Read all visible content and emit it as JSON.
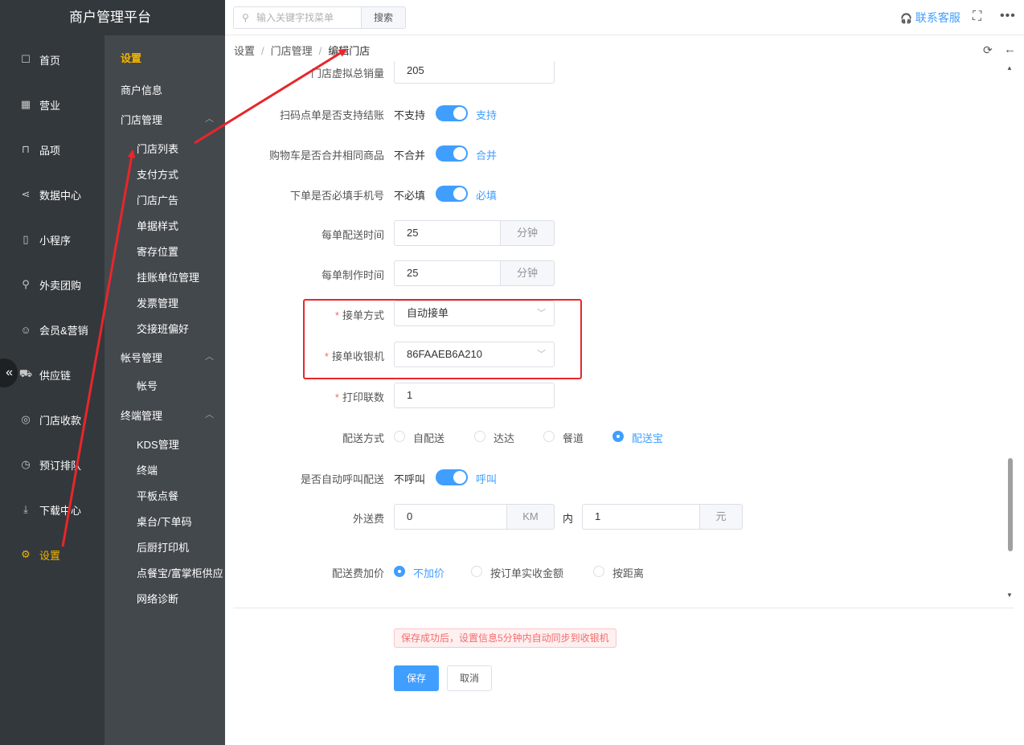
{
  "app": {
    "title": "商户管理平台"
  },
  "nav": {
    "items": [
      {
        "label": "首页",
        "icon": "home-icon",
        "glyph": "☐"
      },
      {
        "label": "营业",
        "icon": "calendar-icon",
        "glyph": "▦"
      },
      {
        "label": "品项",
        "icon": "bag-icon",
        "glyph": "⊓"
      },
      {
        "label": "数据中心",
        "icon": "share-icon",
        "glyph": "⋖"
      },
      {
        "label": "小程序",
        "icon": "phone-icon",
        "glyph": "▯"
      },
      {
        "label": "外卖团购",
        "icon": "bike-icon",
        "glyph": "⚲"
      },
      {
        "label": "会员&营销",
        "icon": "user-icon",
        "glyph": "☺"
      },
      {
        "label": "供应链",
        "icon": "truck-icon",
        "glyph": "⛟"
      },
      {
        "label": "门店收款",
        "icon": "coin-icon",
        "glyph": "◎"
      },
      {
        "label": "预订排队",
        "icon": "clock-icon",
        "glyph": "◷"
      },
      {
        "label": "下载中心",
        "icon": "download-icon",
        "glyph": "⤓"
      },
      {
        "label": "设置",
        "icon": "gear-icon",
        "glyph": "⚙"
      }
    ],
    "collapse_glyph": "«"
  },
  "subnav": {
    "title": "设置",
    "merchant_info": "商户信息",
    "store_group": "门店管理",
    "store_items": [
      "门店列表",
      "支付方式",
      "门店广告",
      "单据样式",
      "寄存位置",
      "挂账单位管理",
      "发票管理",
      "交接班偏好"
    ],
    "account_group": "帐号管理",
    "account_items": [
      "帐号"
    ],
    "terminal_group": "终端管理",
    "terminal_items": [
      "KDS管理",
      "终端",
      "平板点餐",
      "桌台/下单码",
      "后厨打印机",
      "点餐宝/富掌柜供应",
      "网络诊断"
    ],
    "chevron": "︿"
  },
  "topbar": {
    "search_placeholder": "输入关键字找菜单",
    "search_button": "搜索",
    "service": "联系客服",
    "service_glyph": "🎧",
    "fullscreen_glyph": "⛶",
    "more_glyph": "•••"
  },
  "breadcrumb": {
    "items": [
      "设置",
      "门店管理",
      "编辑门店"
    ],
    "separator": "/",
    "refresh_glyph": "⟳",
    "back_glyph": "←"
  },
  "form": {
    "virtual_sales": {
      "label": "门店虚拟总销量",
      "value": "205"
    },
    "scan_checkout": {
      "label": "扫码点单是否支持结账",
      "off": "不支持",
      "on": "支持"
    },
    "cart_merge": {
      "label": "购物车是否合并相同商品",
      "off": "不合并",
      "on": "合并"
    },
    "phone_required": {
      "label": "下单是否必填手机号",
      "off": "不必填",
      "on": "必填"
    },
    "delivery_time": {
      "label": "每单配送时间",
      "value": "25",
      "unit": "分钟"
    },
    "make_time": {
      "label": "每单制作时间",
      "value": "25",
      "unit": "分钟"
    },
    "accept_mode": {
      "label": "接单方式",
      "value": "自动接单"
    },
    "accept_pos": {
      "label": "接单收银机",
      "value": "86FAAEB6A210"
    },
    "print_copies": {
      "label": "打印联数",
      "value": "1"
    },
    "delivery_method": {
      "label": "配送方式",
      "options": [
        "自配送",
        "达达",
        "餐道",
        "配送宝"
      ],
      "selected_index": 3
    },
    "auto_call": {
      "label": "是否自动呼叫配送",
      "off": "不呼叫",
      "on": "呼叫"
    },
    "delivery_fee": {
      "label": "外送费",
      "distance": "0",
      "distance_unit": "KM",
      "within": "内",
      "fee": "1",
      "fee_unit": "元"
    },
    "fee_markup": {
      "label": "配送费加价",
      "options": [
        "不加价",
        "按订单实收金额",
        "按距离"
      ],
      "selected_index": 0
    },
    "required_mark": "*",
    "select_arrow": "﹀"
  },
  "footer": {
    "notice": "保存成功后，设置信息5分钟内自动同步到收银机",
    "save": "保存",
    "cancel": "取消"
  },
  "scrollbar": {
    "up": "▲",
    "down": "▼"
  },
  "colors": {
    "accent": "#409eff",
    "nav_bg": "#33383c",
    "active": "#f4b400",
    "annotation": "#e8262b"
  }
}
